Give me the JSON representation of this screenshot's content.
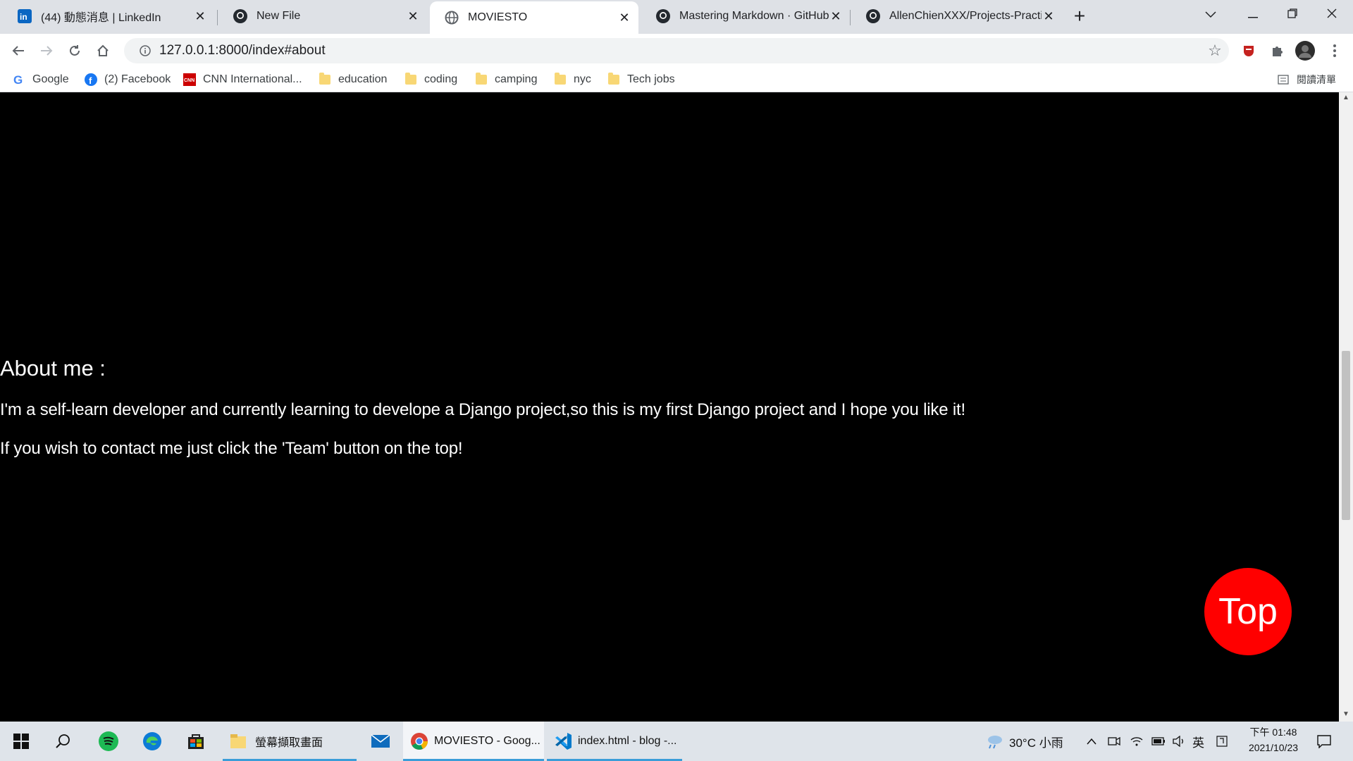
{
  "browser": {
    "tabs": [
      {
        "title": "(44) 動態消息 | LinkedIn",
        "icon": "linkedin-icon",
        "active": false
      },
      {
        "title": "New File",
        "icon": "github-icon",
        "active": false
      },
      {
        "title": "MOVIESTO",
        "icon": "globe-icon",
        "active": true
      },
      {
        "title": "Mastering Markdown · GitHub",
        "icon": "github-icon",
        "active": false
      },
      {
        "title": "AllenChienXXX/Projects-Practice",
        "icon": "github-icon",
        "active": false
      }
    ],
    "close_glyph": "✕",
    "new_tab_glyph": "+",
    "url": "127.0.0.1:8000/index#about",
    "bookmarks": [
      {
        "label": "Google",
        "icon": "google-icon"
      },
      {
        "label": "(2) Facebook",
        "icon": "facebook-icon"
      },
      {
        "label": "CNN International...",
        "icon": "cnn-icon"
      },
      {
        "label": "education",
        "icon": "folder-icon"
      },
      {
        "label": "coding",
        "icon": "folder-icon"
      },
      {
        "label": "camping",
        "icon": "folder-icon"
      },
      {
        "label": "nyc",
        "icon": "folder-icon"
      },
      {
        "label": "Tech jobs",
        "icon": "folder-icon"
      }
    ],
    "reading_list_label": "閱讀清單",
    "colors": {
      "tabstrip": "#dee1e6",
      "omnibox": "#f1f3f4"
    }
  },
  "page": {
    "about_title": "About me :",
    "paragraphs": [
      "I'm a self-learn developer and currently learning to develope a Django project,so this is my first Django project and I hope you like it!",
      "If you wish to contact me just click the 'Team' button on the top!"
    ],
    "top_button_label": "Top",
    "colors": {
      "background": "#000000",
      "text": "#ffffff",
      "top_button": "#ff0000"
    }
  },
  "taskbar": {
    "apps": [
      {
        "label": "螢幕擷取畫面",
        "icon": "file-explorer-icon"
      },
      {
        "label": "MOVIESTO - Goog...",
        "icon": "chrome-icon"
      },
      {
        "label": "index.html - blog -...",
        "icon": "vscode-icon"
      }
    ],
    "weather": "30°C 小雨",
    "ime": "英",
    "clock_time": "下午 01:48",
    "clock_date": "2021/10/23"
  }
}
